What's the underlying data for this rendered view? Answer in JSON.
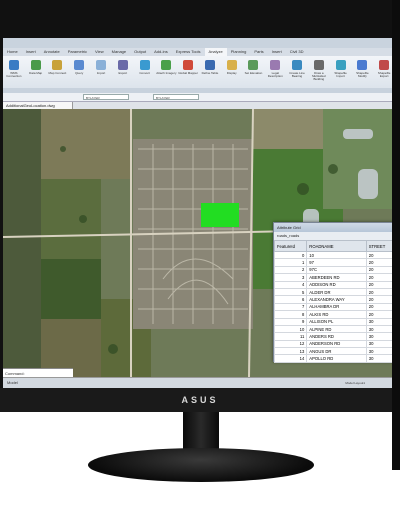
{
  "app": {
    "title": "",
    "ribbon_tabs": [
      "Home",
      "Insert",
      "Annotate",
      "Parametric",
      "View",
      "Manage",
      "Output",
      "Add-ins",
      "Express Tools",
      "Analyze",
      "Planning",
      "Parts",
      "Insert",
      "Civil 3D"
    ]
  },
  "ribbon_buttons": [
    {
      "label": "WMS Connection",
      "color": "#3a7cc4"
    },
    {
      "label": "Data Map",
      "color": "#4a9a4a"
    },
    {
      "label": "Map Connect",
      "color": "#c8a23a"
    },
    {
      "label": "Query",
      "color": "#5a8ad0"
    },
    {
      "label": "Import",
      "color": "#8ab0d8"
    },
    {
      "label": "Export",
      "color": "#6a6aa8"
    },
    {
      "label": "Convert",
      "color": "#3a9ad0"
    },
    {
      "label": "Attach Imagery",
      "color": "#4aa04a"
    },
    {
      "label": "Global Mapper",
      "color": "#d04a3a"
    },
    {
      "label": "Define Table",
      "color": "#3a6ab0"
    },
    {
      "label": "Display",
      "color": "#d8b04a"
    },
    {
      "label": "Set Elevation",
      "color": "#5a9a5a"
    },
    {
      "label": "Legal Description",
      "color": "#9a7ab0"
    },
    {
      "label": "Create Line Bearing",
      "color": "#3a8ac0"
    },
    {
      "label": "Draw a Multisided Building",
      "color": "#6a6a6a"
    },
    {
      "label": "Shapefile Import",
      "color": "#3aa0c0"
    },
    {
      "label": "Shapefile Modify",
      "color": "#4a7ad0"
    },
    {
      "label": "Shapefile Export",
      "color": "#c04a4a"
    }
  ],
  "addressbar": {
    "layer1": "BYLAYER",
    "layer2": "BYLAYER"
  },
  "document_tab": "AdditionalGeoLocation.dwg",
  "command_line": "Command:",
  "statusbar": {
    "left": "Model",
    "right": "Model  Layout1"
  },
  "attribute_window": {
    "title": "Attribute Grid",
    "subtitle": "roads_roads",
    "columns": [
      "FeatureId",
      "ROADNAME",
      "STREET"
    ],
    "rows": [
      {
        "id": "0",
        "name": "10",
        "street": "20"
      },
      {
        "id": "1",
        "name": "97",
        "street": "20"
      },
      {
        "id": "2",
        "name": "97C",
        "street": "20"
      },
      {
        "id": "3",
        "name": "ABERDEEN RD",
        "street": "20"
      },
      {
        "id": "4",
        "name": "ADDISON RD",
        "street": "20"
      },
      {
        "id": "5",
        "name": "ALDER DR",
        "street": "20"
      },
      {
        "id": "6",
        "name": "ALEXANDRA WAY",
        "street": "20"
      },
      {
        "id": "7",
        "name": "ALHAMBRA DR",
        "street": "20"
      },
      {
        "id": "8",
        "name": "ALKIS RD",
        "street": "20"
      },
      {
        "id": "9",
        "name": "ALLISON PL",
        "street": "30"
      },
      {
        "id": "10",
        "name": "ALPINE RD",
        "street": "30"
      },
      {
        "id": "11",
        "name": "ANDERS RD",
        "street": "30"
      },
      {
        "id": "12",
        "name": "ANDERSON RD",
        "street": "30"
      },
      {
        "id": "13",
        "name": "ANGUS DR",
        "street": "30"
      },
      {
        "id": "14",
        "name": "APOLLO RD",
        "street": "30"
      }
    ]
  },
  "monitor": {
    "brand": "ASUS"
  },
  "colors": {
    "selection_green": "#22dd22"
  }
}
